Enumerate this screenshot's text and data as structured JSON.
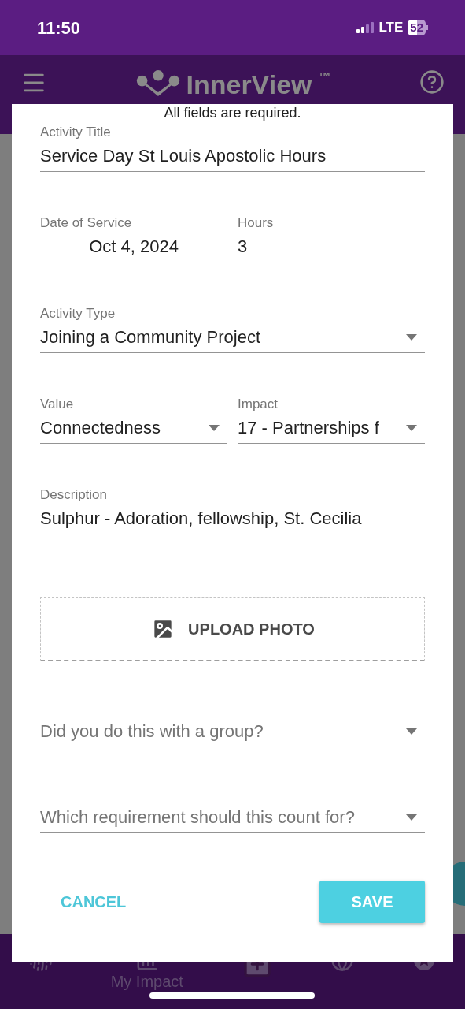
{
  "status_bar": {
    "time": "11:50",
    "network": "LTE",
    "battery": "52"
  },
  "app_bar": {
    "title": "InnerView",
    "trademark": "™"
  },
  "dialog": {
    "note": "All fields are required.",
    "rows": [
      [
        {
          "kind": "text",
          "label": "Activity Title",
          "value": "Service Day St Louis Apostolic Hours"
        }
      ],
      [
        {
          "kind": "date",
          "label": "Date of Service",
          "value": "Oct 4, 2024"
        },
        {
          "kind": "text",
          "label": "Hours",
          "value": "3"
        }
      ],
      [
        {
          "kind": "select",
          "label": "Activity Type",
          "value": "Joining a Community Project"
        }
      ],
      [
        {
          "kind": "select",
          "label": "Value",
          "value": "Connectedness"
        },
        {
          "kind": "select",
          "label": "Impact",
          "value": "17 - Partnerships f"
        }
      ],
      [
        {
          "kind": "text",
          "label": "Description",
          "value": "Sulphur - Adoration, fellowship, St. Cecilia"
        }
      ]
    ],
    "upload": {
      "label": "UPLOAD PHOTO"
    },
    "selects": [
      {
        "placeholder": "Did you do this with a group?"
      },
      {
        "placeholder": "Which requirement should this count for?"
      }
    ],
    "buttons": [
      {
        "kind": "flat",
        "label": "CANCEL"
      },
      {
        "kind": "raised",
        "label": "SAVE"
      }
    ]
  },
  "bottom_nav": {
    "items": [
      {
        "kind": "fingerprint"
      },
      {
        "kind": "chart",
        "label": "My Impact"
      },
      {
        "kind": "add"
      },
      {
        "kind": "globe"
      },
      {
        "kind": "star"
      }
    ]
  }
}
